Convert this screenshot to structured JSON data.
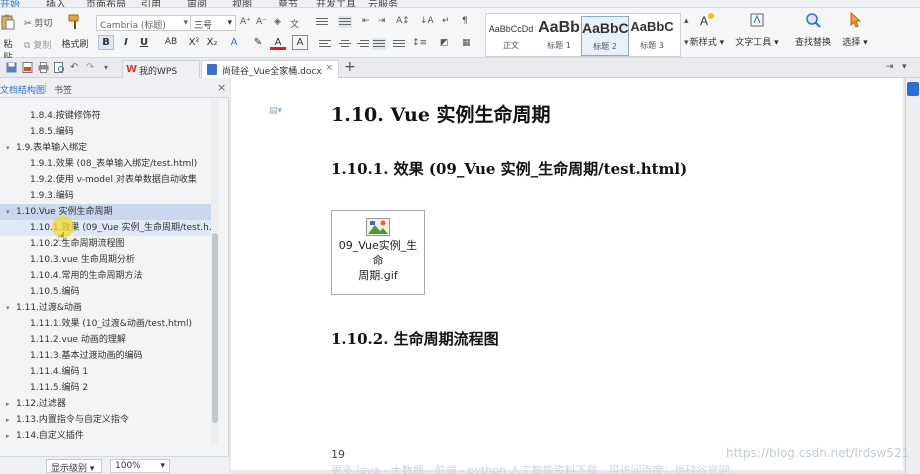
{
  "menubar": {
    "tabs": [
      "开始",
      "插入",
      "页面布局",
      "引用",
      "审阅",
      "视图",
      "章节",
      "开发工具",
      "云服务"
    ]
  },
  "ribbon": {
    "paste": "粘贴",
    "cut": "剪切",
    "copy": "复制",
    "format_painter": "格式刷",
    "font_name": "Cambria (标题)",
    "font_size": "三号",
    "styles": [
      {
        "preview": "AaBbCcDd",
        "name": "正文"
      },
      {
        "preview": "AaBb",
        "name": "标题 1"
      },
      {
        "preview": "AaBbC",
        "name": "标题 2"
      },
      {
        "preview": "AaBbC",
        "name": "标题 3"
      }
    ],
    "new_style": "新样式",
    "text_tools": "文字工具",
    "find_replace": "查找替换",
    "select": "选择"
  },
  "tabbar": {
    "wps_tab": "我的WPS",
    "doc_tab": "尚硅谷_Vue全家桶.docx"
  },
  "panel": {
    "tab_outline": "文档结构图",
    "tab_bookmark": "书签",
    "tree": [
      {
        "label": "1.8.4.按键修饰符",
        "level": 2,
        "toggle": ""
      },
      {
        "label": "1.8.5.编码",
        "level": 2,
        "toggle": ""
      },
      {
        "label": "1.9.表单输入绑定",
        "level": 1,
        "toggle": "▾"
      },
      {
        "label": "1.9.1.效果 (08_表单输入绑定/test.html)",
        "level": 2,
        "toggle": ""
      },
      {
        "label": "1.9.2.使用 v-model 对表单数据自动收集",
        "level": 2,
        "toggle": ""
      },
      {
        "label": "1.9.3.编码",
        "level": 2,
        "toggle": ""
      },
      {
        "label": "1.10.Vue 实例生命周期",
        "level": 1,
        "toggle": "▾",
        "state": "sel"
      },
      {
        "label": "1.10.1.效果 (09_Vue 实例_生命周期/test.h…",
        "level": 2,
        "toggle": "",
        "state": "cur"
      },
      {
        "label": "1.10.2.生命周期流程图",
        "level": 2,
        "toggle": ""
      },
      {
        "label": "1.10.3.vue 生命周期分析",
        "level": 2,
        "toggle": ""
      },
      {
        "label": "1.10.4.常用的生命周期方法",
        "level": 2,
        "toggle": ""
      },
      {
        "label": "1.10.5.编码",
        "level": 2,
        "toggle": ""
      },
      {
        "label": "1.11.过渡&动画",
        "level": 1,
        "toggle": "▾"
      },
      {
        "label": "1.11.1.效果 (10_过渡&动画/test.html)",
        "level": 2,
        "toggle": ""
      },
      {
        "label": "1.11.2.vue 动画的理解",
        "level": 2,
        "toggle": ""
      },
      {
        "label": "1.11.3.基本过渡动画的编码",
        "level": 2,
        "toggle": ""
      },
      {
        "label": "1.11.4.编码 1",
        "level": 2,
        "toggle": ""
      },
      {
        "label": "1.11.5.编码 2",
        "level": 2,
        "toggle": ""
      },
      {
        "label": "1.12.过滤器",
        "level": 1,
        "toggle": "▸"
      },
      {
        "label": "1.13.内置指令与自定义指令",
        "level": 1,
        "toggle": "▸"
      },
      {
        "label": "1.14.自定义插件",
        "level": 1,
        "toggle": "▸"
      }
    ],
    "display_level": "显示级别",
    "zoom": "100%"
  },
  "document": {
    "h2": "1.10.  Vue 实例生命周期",
    "h3_effect": "1.10.1.  效果  (09_Vue 实例_生命周期/test.html)",
    "attachment_lines": [
      "09_Vue实例_生命",
      "周期.gif"
    ],
    "h3_flow": "1.10.2.  生命周期流程图",
    "page_number": "19",
    "overlay_text": "更多 Java - 大数据 - 前端 - python 人工智能资料下载，可访问百度：尚硅谷官网",
    "watermark": "https://blog.csdn.net/Irdsw521"
  },
  "colors": {
    "accent": "#2a6fd6",
    "selection": "#c9d8ef",
    "cursor_highlight": "#f0dc28"
  }
}
